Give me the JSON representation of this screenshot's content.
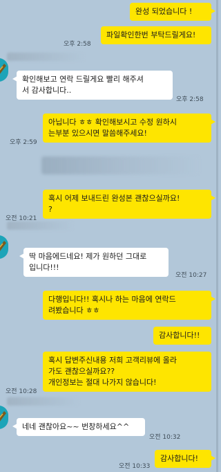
{
  "messages": [
    {
      "from": "me",
      "text": "완성 되었습니다 !"
    },
    {
      "from": "me",
      "text": "파일확인한번 부탁드릴게요!",
      "time": "오후 2:58"
    },
    {
      "from": "them",
      "text": "확인해보고 연락 드릴게요 빨리 해주셔\n서 감사합니다..",
      "time": "오후 2:58"
    },
    {
      "from": "me",
      "text": "아닙니다 ㅎㅎ 확인해보시고 수정 원하시\n는부분 있으시면 말씀해주세요!",
      "time": "오후 2:59"
    },
    {
      "from": "me",
      "text": "혹시 어제 보내드린 완성본 괜찮으실까요!\n?",
      "time": "오전 10:21"
    },
    {
      "from": "them",
      "text": "딱 마음에드네요! 제가 원하던 그대로\n입니다!!!",
      "time": "오전 10:27"
    },
    {
      "from": "me",
      "text": "다행입니다!! 혹시나 하는 마음에 연락드\n려봤습니다 ㅎㅎ"
    },
    {
      "from": "me",
      "text": "감사합니다!!"
    },
    {
      "from": "me",
      "text": "혹시 답변주신내용 저희 고객리뷰에 올라\n가도 괜찮으실까요??\n개인정보는 절대 나가지 않습니다!",
      "time": "오전 10:28"
    },
    {
      "from": "them",
      "text": "네네 괜찮아요~~ 번창하세요^^",
      "time": "오전 10:32"
    },
    {
      "from": "me",
      "text": "감사합니다!",
      "time": "오전 10:33"
    }
  ],
  "theme": {
    "background": "#b2c7d9",
    "my_bubble": "#fee500",
    "their_bubble": "#ffffff",
    "avatar": "#1da4b8"
  },
  "icons": {
    "avatar": "profile-avatar-icon"
  }
}
